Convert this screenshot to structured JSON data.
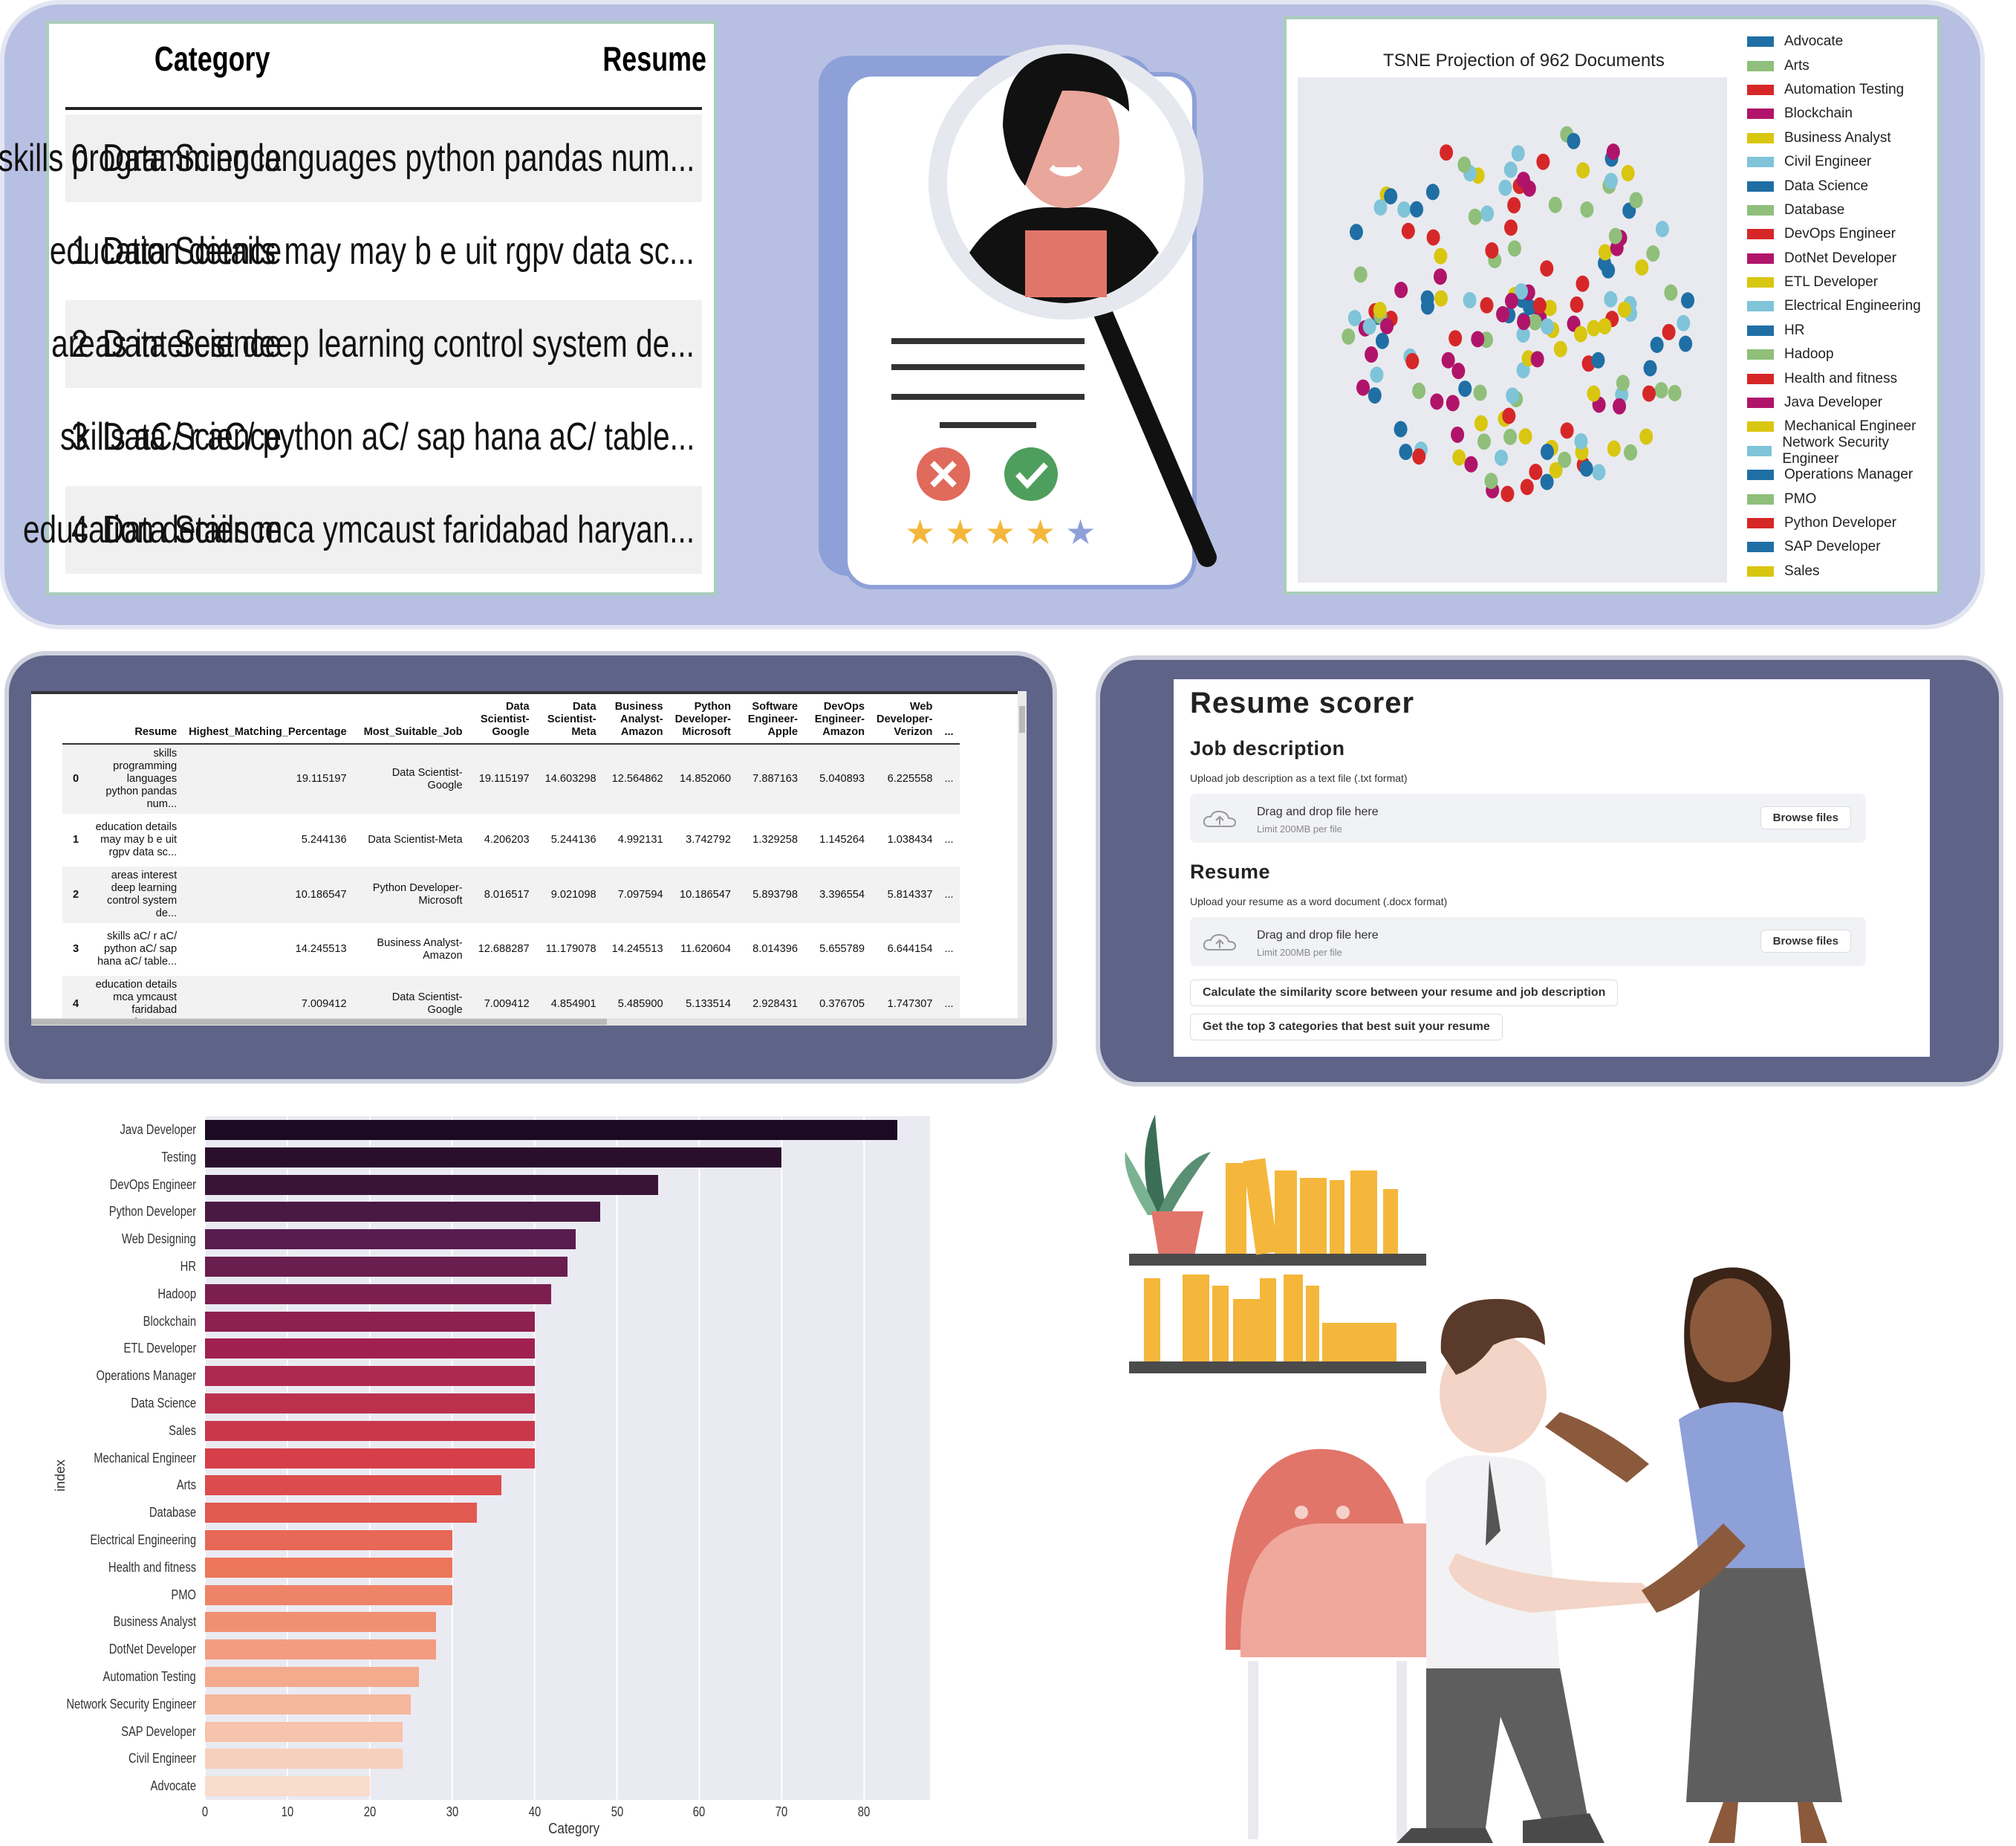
{
  "category_table": {
    "headers": [
      "Category",
      "Resume"
    ],
    "rows": [
      {
        "idx": "0",
        "category": "Data Science",
        "resume": "skills programming languages python pandas num..."
      },
      {
        "idx": "1",
        "category": "Data Science",
        "resume": "education details may may b e uit rgpv data sc..."
      },
      {
        "idx": "2",
        "category": "Data Science",
        "resume": "areas interest deep learning control system de..."
      },
      {
        "idx": "3",
        "category": "Data Science",
        "resume": "skills aC/ r aC/ python aC/ sap hana aC/ table..."
      },
      {
        "idx": "4",
        "category": "Data Science",
        "resume": "education details mca ymcaust faridabad haryan..."
      }
    ]
  },
  "illustration_top": {
    "icons": [
      "magnifier-icon",
      "reject-icon",
      "approve-icon",
      "star-icon"
    ]
  },
  "tsne": {
    "title": "TSNE Projection of 962 Documents",
    "legend": [
      {
        "label": "Advocate",
        "color": "#1f6fa5"
      },
      {
        "label": "Arts",
        "color": "#8fbf7a"
      },
      {
        "label": "Automation Testing",
        "color": "#d62728"
      },
      {
        "label": "Blockchain",
        "color": "#b0146a"
      },
      {
        "label": "Business Analyst",
        "color": "#d8c611"
      },
      {
        "label": "Civil Engineer",
        "color": "#7fc4d9"
      },
      {
        "label": "Data Science",
        "color": "#1f6fa5"
      },
      {
        "label": "Database",
        "color": "#8fbf7a"
      },
      {
        "label": "DevOps Engineer",
        "color": "#d62728"
      },
      {
        "label": "DotNet Developer",
        "color": "#b0146a"
      },
      {
        "label": "ETL Developer",
        "color": "#d8c611"
      },
      {
        "label": "Electrical Engineering",
        "color": "#7fc4d9"
      },
      {
        "label": "HR",
        "color": "#1f6fa5"
      },
      {
        "label": "Hadoop",
        "color": "#8fbf7a"
      },
      {
        "label": "Health and fitness",
        "color": "#d62728"
      },
      {
        "label": "Java Developer",
        "color": "#b0146a"
      },
      {
        "label": "Mechanical Engineer",
        "color": "#d8c611"
      },
      {
        "label": "Network Security Engineer",
        "color": "#7fc4d9"
      },
      {
        "label": "Operations Manager",
        "color": "#1f6fa5"
      },
      {
        "label": "PMO",
        "color": "#8fbf7a"
      },
      {
        "label": "Python Developer",
        "color": "#d62728"
      },
      {
        "label": "SAP Developer",
        "color": "#1f6fa5"
      },
      {
        "label": "Sales",
        "color": "#d8c611"
      }
    ]
  },
  "match_table": {
    "columns": [
      "",
      "Resume",
      "Highest_Matching_Percentage",
      "Most_Suitable_Job",
      "Data Scientist- Google",
      "Data Scientist- Meta",
      "Business Analyst- Amazon",
      "Python Developer- Microsoft",
      "Software Engineer- Apple",
      "DevOps Engineer- Amazon",
      "Web Developer- Verizon",
      "..."
    ],
    "rows": [
      [
        "0",
        "skills programming languages python pandas num...",
        "19.115197",
        "Data Scientist- Google",
        "19.115197",
        "14.603298",
        "12.564862",
        "14.852060",
        "7.887163",
        "5.040893",
        "6.225558",
        "..."
      ],
      [
        "1",
        "education details may may b e uit rgpv data sc...",
        "5.244136",
        "Data Scientist-Meta",
        "4.206203",
        "5.244136",
        "4.992131",
        "3.742792",
        "1.329258",
        "1.145264",
        "1.038434",
        "..."
      ],
      [
        "2",
        "areas interest deep learning control system de...",
        "10.186547",
        "Python Developer- Microsoft",
        "8.016517",
        "9.021098",
        "7.097594",
        "10.186547",
        "5.893798",
        "3.396554",
        "5.814337",
        "..."
      ],
      [
        "3",
        "skills aC/ r aC/ python aC/ sap hana aC/ table...",
        "14.245513",
        "Business Analyst- Amazon",
        "12.688287",
        "11.179078",
        "14.245513",
        "11.620604",
        "8.014396",
        "5.655789",
        "6.644154",
        "..."
      ],
      [
        "4",
        "education details mca ymcaust faridabad haryan...",
        "7.009412",
        "Data Scientist- Google",
        "7.009412",
        "4.854901",
        "5.485900",
        "5.133514",
        "2.928431",
        "0.376705",
        "1.747307",
        "..."
      ]
    ]
  },
  "resume_scorer": {
    "title": "Resume scorer",
    "job_heading": "Job description",
    "job_caption": "Upload job description as a text file (.txt format)",
    "resume_heading": "Resume",
    "resume_caption": "Upload your resume as a word document (.docx format)",
    "drop_text": "Drag and drop file here",
    "limit_text": "Limit 200MB per file",
    "browse_label": "Browse files",
    "btn_similarity": "Calculate the similarity score between your resume and job description",
    "btn_top3": "Get the top 3 categories that best suit your resume"
  },
  "chart_data": {
    "type": "bar",
    "orientation": "horizontal",
    "xlabel": "Category",
    "ylabel": "index",
    "xlim": [
      0,
      88
    ],
    "xticks": [
      "0",
      "10",
      "20",
      "30",
      "40",
      "50",
      "60",
      "70",
      "80"
    ],
    "grid": true,
    "categories": [
      "Java Developer",
      "Testing",
      "DevOps Engineer",
      "Python Developer",
      "Web Designing",
      "HR",
      "Hadoop",
      "Blockchain",
      "ETL Developer",
      "Operations Manager",
      "Data Science",
      "Sales",
      "Mechanical Engineer",
      "Arts",
      "Database",
      "Electrical Engineering",
      "Health and fitness",
      "PMO",
      "Business Analyst",
      "DotNet Developer",
      "Automation Testing",
      "Network Security Engineer",
      "SAP Developer",
      "Civil Engineer",
      "Advocate"
    ],
    "values": [
      84,
      70,
      55,
      48,
      45,
      44,
      42,
      40,
      40,
      40,
      40,
      40,
      40,
      36,
      33,
      30,
      30,
      30,
      28,
      28,
      26,
      25,
      24,
      24,
      20
    ]
  },
  "illustration_bottom": {
    "icons": [
      "handshake-illustration",
      "bookshelf-icon",
      "plant-icon",
      "chair-icon"
    ]
  }
}
